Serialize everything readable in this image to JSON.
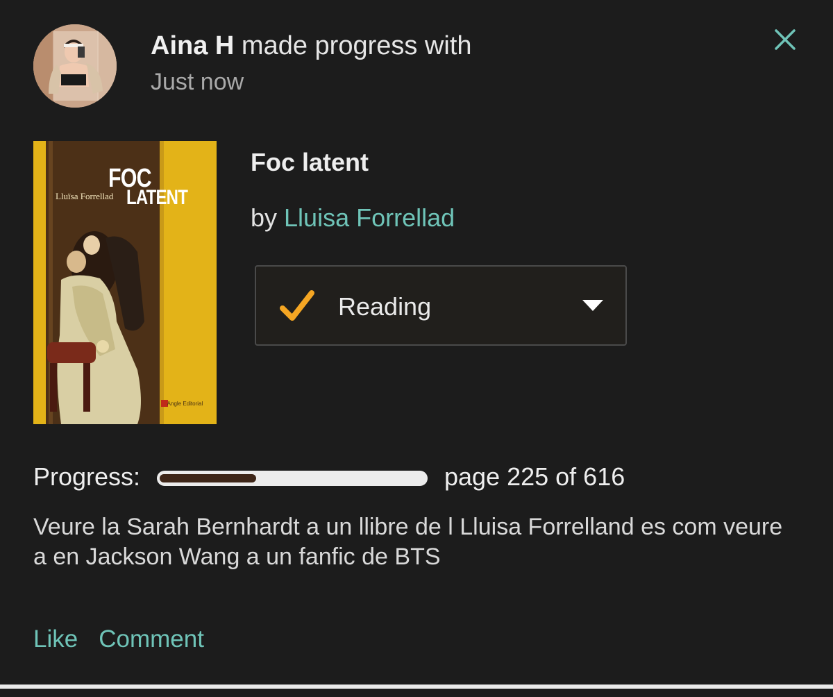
{
  "header": {
    "user_name": "Aina H",
    "action_text": " made progress with",
    "timestamp": "Just now",
    "close_icon": "close-icon"
  },
  "book": {
    "title": "Foc latent",
    "by_prefix": "by ",
    "author": "Lluisa Forrellad",
    "cover": {
      "title_line_1": "FOC",
      "title_line_2": "LATENT",
      "author_text": "Lluïsa Forrellad",
      "publisher": "Angle Editorial",
      "background_color": "#e3b318"
    }
  },
  "shelf": {
    "status_label": "Reading",
    "check_icon": "checkmark-icon",
    "caret_icon": "caret-down-icon",
    "check_color": "#f5a623"
  },
  "progress": {
    "label": "Progress:",
    "current_page": 225,
    "total_pages": 616,
    "fraction": 0.365,
    "text": "page 225 of 616",
    "fill_color": "#3e2618"
  },
  "status_body": "Veure la Sarah Bernhardt a un llibre de l Lluisa Forrelland es com veure a en Jackson Wang a un fanfic de BTS",
  "actions": {
    "like_label": "Like",
    "comment_label": "Comment"
  },
  "colors": {
    "background": "#1c1c1c",
    "accent": "#6fc4b8",
    "text_primary": "#eeeeee",
    "text_secondary": "#a9a9a9"
  }
}
